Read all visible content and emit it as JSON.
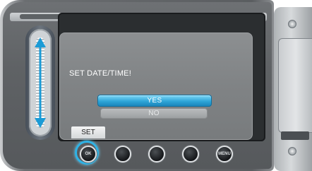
{
  "screen": {
    "message": "SET DATE/TIME!",
    "options": [
      {
        "label": "YES",
        "selected": true
      },
      {
        "label": "NO",
        "selected": false
      }
    ]
  },
  "set_tab": {
    "label": "SET"
  },
  "bottom_buttons": [
    {
      "name": "ok",
      "label": "OK",
      "highlighted": true
    },
    {
      "name": "button-2",
      "label": ""
    },
    {
      "name": "button-3",
      "label": ""
    },
    {
      "name": "button-4",
      "label": ""
    },
    {
      "name": "menu",
      "label": "MENU"
    }
  ],
  "colors": {
    "accent": "#2fa6d8",
    "ring": "#2fb3e6"
  }
}
